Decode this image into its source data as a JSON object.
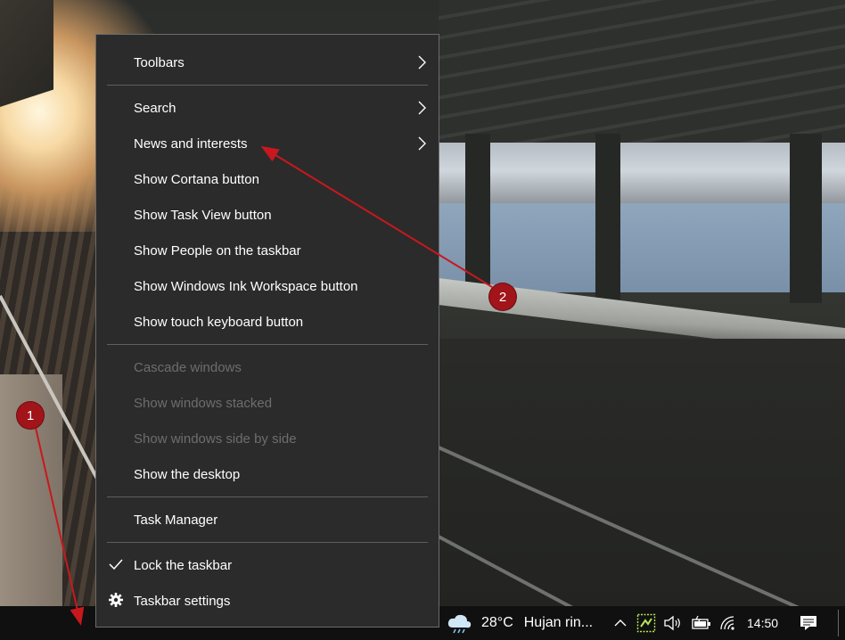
{
  "context_menu": {
    "items": [
      {
        "label": "Toolbars"
      },
      {
        "label": "Search"
      },
      {
        "label": "News and interests"
      },
      {
        "label": "Show Cortana button"
      },
      {
        "label": "Show Task View button"
      },
      {
        "label": "Show People on the taskbar"
      },
      {
        "label": "Show Windows Ink Workspace button"
      },
      {
        "label": "Show touch keyboard button"
      },
      {
        "label": "Cascade windows"
      },
      {
        "label": "Show windows stacked"
      },
      {
        "label": "Show windows side by side"
      },
      {
        "label": "Show the desktop"
      },
      {
        "label": "Task Manager"
      },
      {
        "label": "Lock the taskbar"
      },
      {
        "label": "Taskbar settings"
      }
    ]
  },
  "taskbar": {
    "weather_temp": "28°C",
    "weather_text": "Hujan rin...",
    "clock": "14:50"
  },
  "annotations": {
    "badge1": "1",
    "badge2": "2"
  },
  "colors": {
    "menu_bg": "#2b2b2b",
    "disabled_text": "#6d6d6d",
    "annotation_red": "#a0141a"
  }
}
